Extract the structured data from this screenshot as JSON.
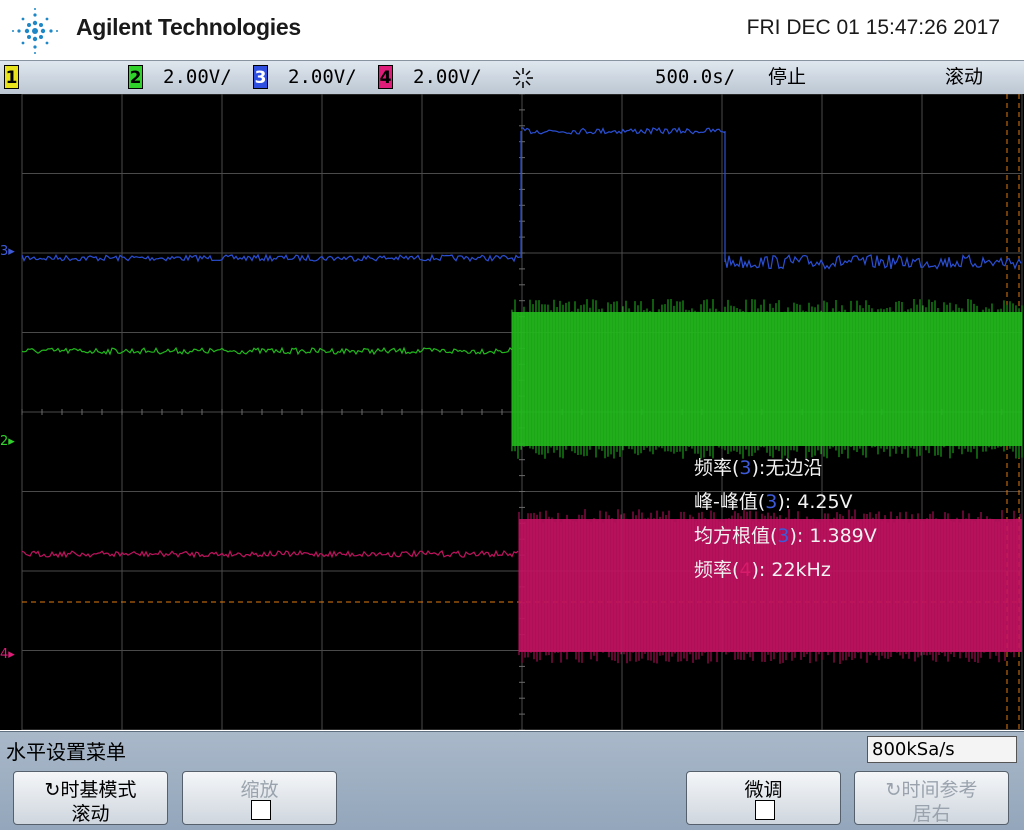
{
  "header": {
    "brand": "Agilent Technologies",
    "datetime": "FRI DEC 01 15:47:26 2017"
  },
  "status": {
    "ch1": {
      "num": "1",
      "color": "#e8e21c"
    },
    "ch2": {
      "num": "2",
      "scale": "2.00V/",
      "color": "#2fd12a"
    },
    "ch3": {
      "num": "3",
      "scale": "2.00V/",
      "color": "#2f4fe0"
    },
    "ch4": {
      "num": "4",
      "scale": "2.00V/",
      "color": "#e01c7a"
    },
    "timebase": "500.0s/",
    "run_state": "停止",
    "mode": "滚动"
  },
  "markers": {
    "ch3": "3",
    "ch2": "2",
    "ch4": "4"
  },
  "measurements": [
    {
      "label": "频率(",
      "ch": "3",
      "rest": "):无边沿"
    },
    {
      "label": "峰-峰值(",
      "ch": "3",
      "rest": "): 4.25V"
    },
    {
      "label": "均方根值(",
      "ch": "3",
      "rest": "): 1.389V"
    },
    {
      "label": "频率(",
      "ch": "4",
      "rest": "): 22kHz"
    }
  ],
  "menu": {
    "title": "水平设置菜单",
    "sample_rate": "800kSa/s",
    "softkeys": {
      "timebase_mode": {
        "line1": "时基模式",
        "line2": "滚动"
      },
      "zoom": {
        "line1": "缩放"
      },
      "vernier": {
        "line1": "微调"
      },
      "time_ref": {
        "line1": "时间参考",
        "line2": "居右"
      }
    }
  },
  "colors": {
    "ch2_trace": "#21b81c",
    "ch3_trace": "#2a4fd4",
    "ch4_trace": "#c0125f",
    "grid": "#4a4a4a",
    "trigger_level": "#e07a10"
  }
}
